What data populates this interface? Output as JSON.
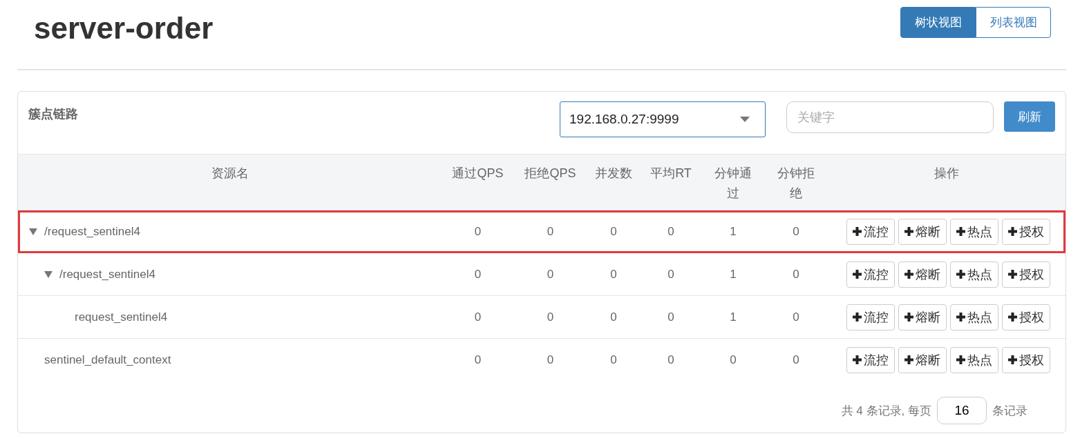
{
  "title": "server-order",
  "view_tabs": [
    {
      "label": "树状视图",
      "selected": true
    },
    {
      "label": "列表视图",
      "selected": false
    }
  ],
  "panel": {
    "title": "簇点链路",
    "machine_select": {
      "value": "192.168.0.27:9999"
    },
    "search": {
      "placeholder": "关键字"
    },
    "refresh_button": "刷新"
  },
  "table": {
    "columns": [
      "资源名",
      "通过QPS",
      "拒绝QPS",
      "并发数",
      "平均RT",
      "分钟通过",
      "分钟拒绝",
      "操作"
    ],
    "rows": [
      {
        "name": "/request_sentinel4",
        "highlighted": true,
        "expanded": true,
        "values": [
          "0",
          "0",
          "0",
          "0",
          "1",
          "0"
        ],
        "actions": [
          "流控",
          "熔断",
          "热点",
          "授权"
        ],
        "children": [
          {
            "name": "/request_sentinel4",
            "highlighted": false,
            "expanded": true,
            "values": [
              "0",
              "0",
              "0",
              "0",
              "1",
              "0"
            ],
            "actions": [
              "流控",
              "熔断",
              "热点",
              "授权"
            ],
            "children": [
              {
                "name": "request_sentinel4",
                "highlighted": false,
                "values": [
                  "0",
                  "0",
                  "0",
                  "0",
                  "1",
                  "0"
                ],
                "actions": [
                  "流控",
                  "熔断",
                  "热点",
                  "授权"
                ]
              }
            ]
          }
        ]
      },
      {
        "name": "sentinel_default_context",
        "highlighted": false,
        "values": [
          "0",
          "0",
          "0",
          "0",
          "0",
          "0"
        ],
        "actions": [
          "流控",
          "熔断",
          "热点",
          "授权"
        ]
      }
    ]
  },
  "pagination": {
    "total_text": "共 4 条记录, 每页",
    "page_size": "16",
    "suffix": "条记录"
  }
}
